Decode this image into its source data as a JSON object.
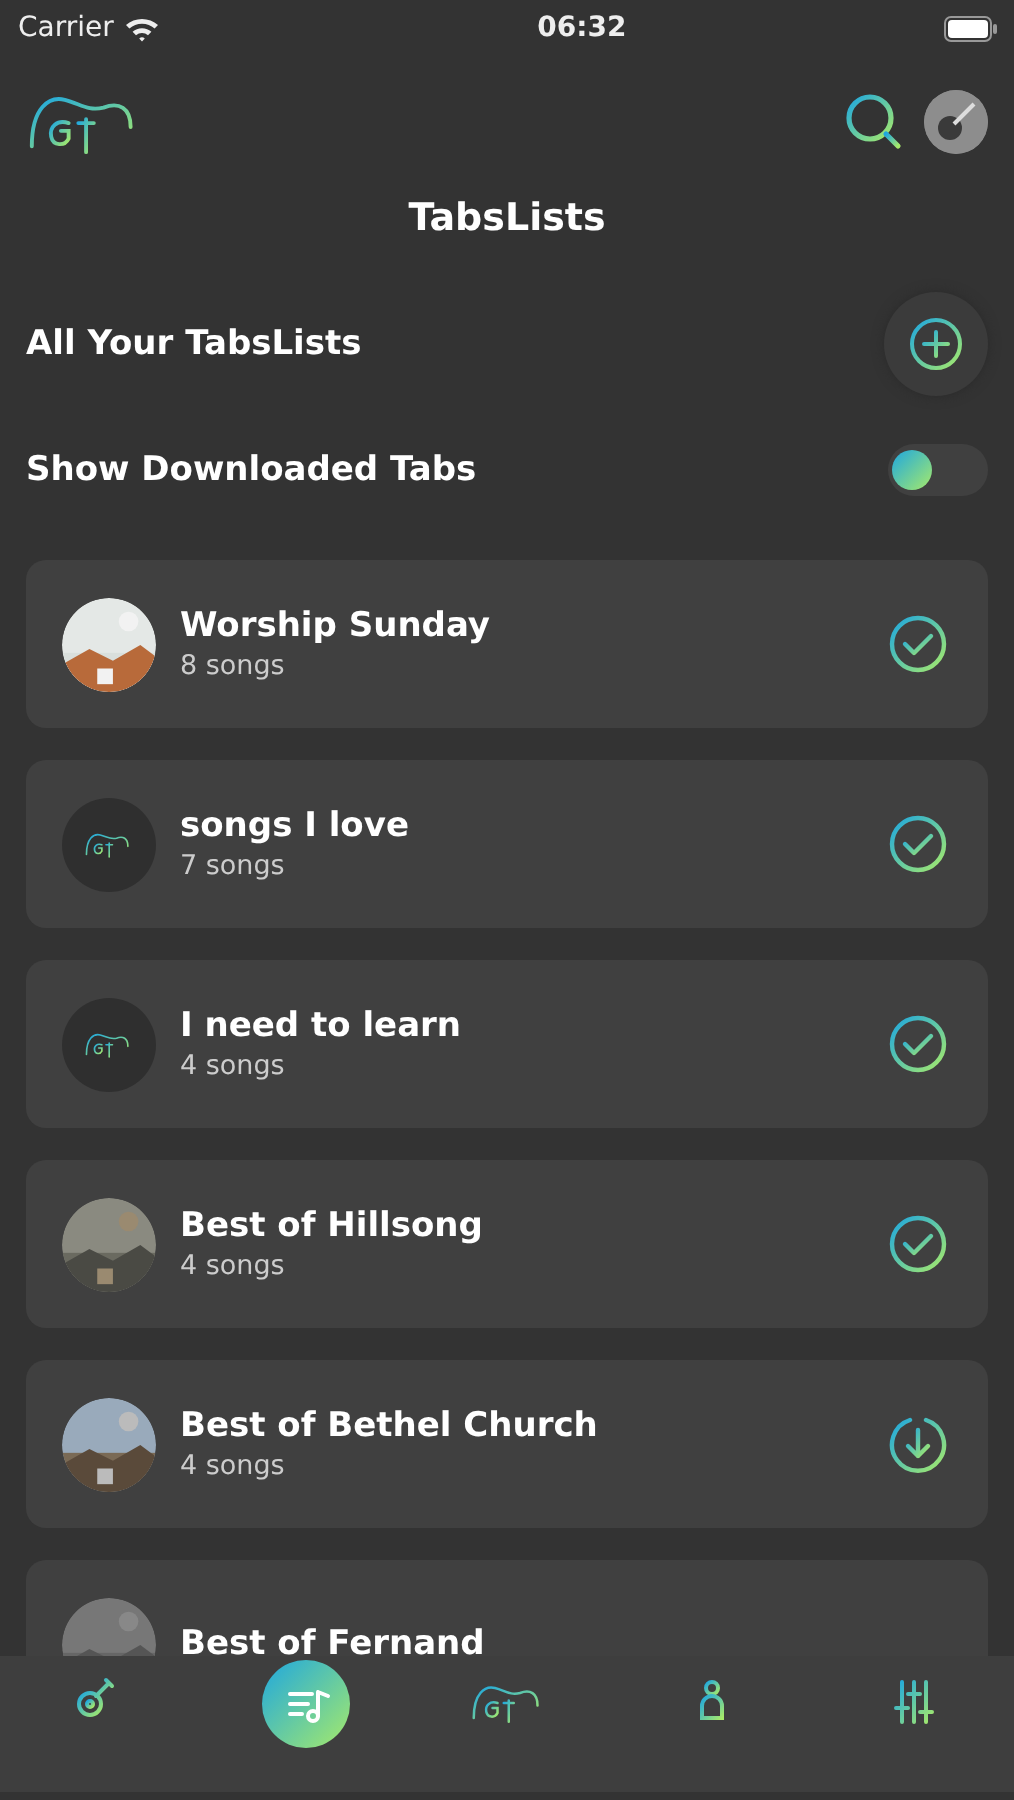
{
  "status_bar": {
    "carrier": "Carrier",
    "time": "06:32"
  },
  "header": {
    "title": "TabsLists"
  },
  "section": {
    "title": "All Your TabsLists"
  },
  "downloaded_toggle": {
    "label": "Show Downloaded Tabs",
    "on": false
  },
  "tabslists": [
    {
      "name": "Worship Sunday",
      "count": "8 songs",
      "kind": "picture",
      "downloaded": true
    },
    {
      "name": "songs I love",
      "count": "7 songs",
      "kind": "logo",
      "downloaded": true
    },
    {
      "name": "I need to learn",
      "count": "4 songs",
      "kind": "logo",
      "downloaded": true
    },
    {
      "name": "Best of Hillsong",
      "count": "4 songs",
      "kind": "picture",
      "downloaded": true
    },
    {
      "name": "Best of Bethel Church",
      "count": "4 songs",
      "kind": "picture",
      "downloaded": false
    },
    {
      "name": "Best of Fernand",
      "kind": "picture"
    }
  ],
  "tab_bar": [
    {
      "selected": false
    },
    {
      "selected": true
    },
    {
      "selected": false
    },
    {
      "selected": false
    },
    {
      "selected": false
    }
  ]
}
